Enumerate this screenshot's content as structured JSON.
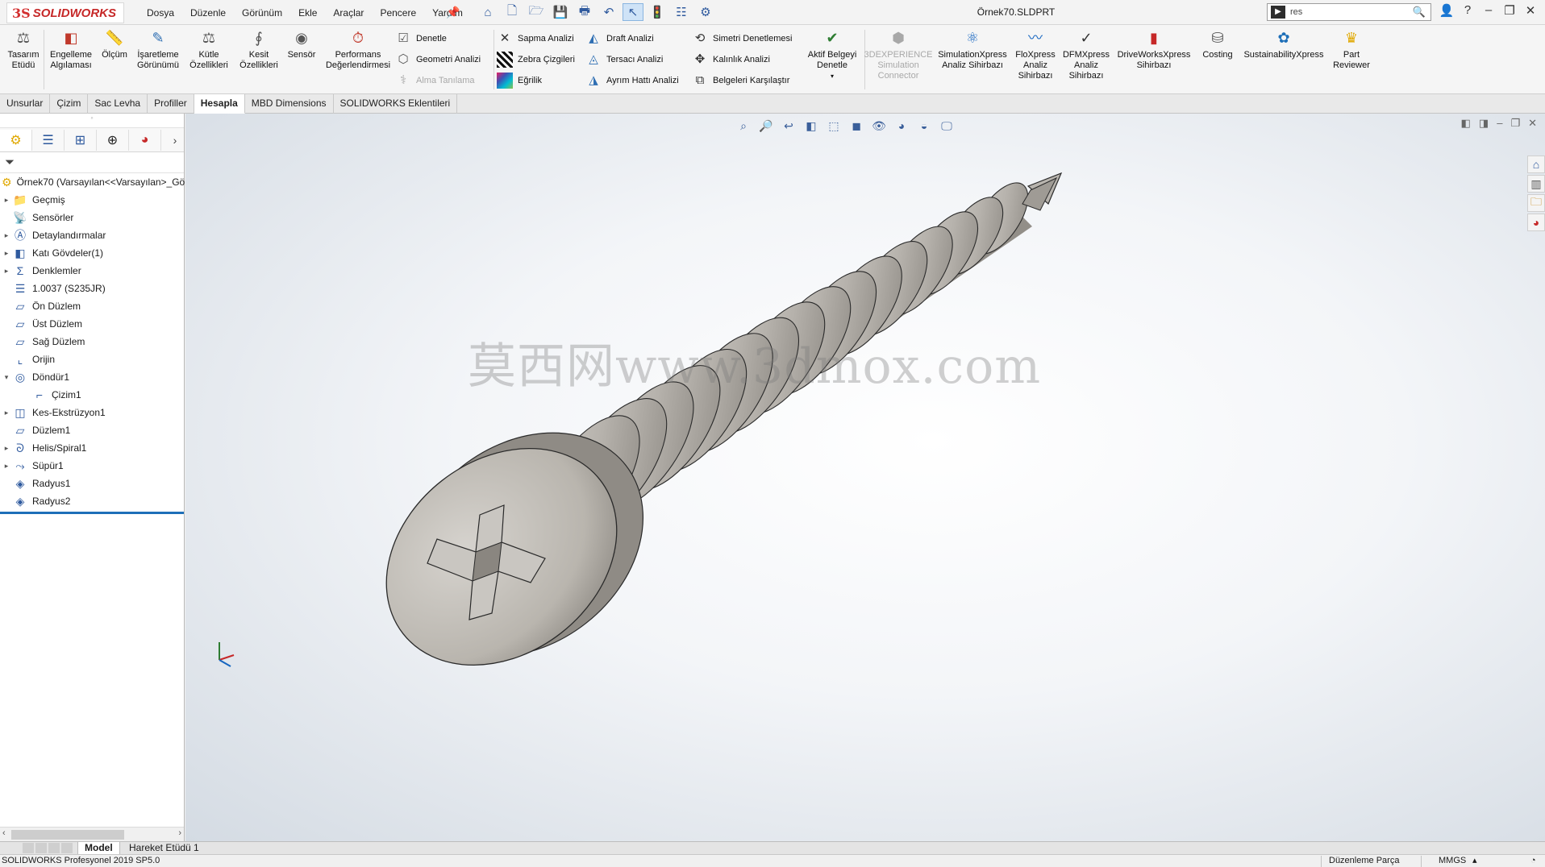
{
  "app": {
    "brand_prefix": "3S",
    "brand": "SOLIDWORKS"
  },
  "menu": [
    "Dosya",
    "Düzenle",
    "Görünüm",
    "Ekle",
    "Araçlar",
    "Pencere",
    "Yardım"
  ],
  "document_title": "Örnek70.SLDPRT",
  "search": {
    "value": "res"
  },
  "commands": {
    "tasarim_etudu": "Tasarım\nEtüdü",
    "engelleme": "Engelleme\nAlgılaması",
    "olcum": "Ölçüm",
    "isaretleme": "İşaretleme\nGörünümü",
    "kutle": "Kütle\nÖzellikleri",
    "kesit": "Kesit\nÖzellikleri",
    "sensor": "Sensör",
    "performans": "Performans\nDeğerlendirmesi",
    "denetle": "Denetle",
    "geometri": "Geometri Analizi",
    "alma": "Alma Tanılama",
    "sapma": "Sapma Analizi",
    "zebra": "Zebra Çizgileri",
    "egrilik": "Eğrilik",
    "draft": "Draft Analizi",
    "tersaci": "Tersacı Analizi",
    "ayrim": "Ayrım Hattı Analizi",
    "simetri": "Simetri Denetlemesi",
    "kalinlik": "Kalınlık Analizi",
    "belgeleri": "Belgeleri  Karşılaştır",
    "aktif": "Aktif Belgeyi\nDenetle",
    "experience": "3DEXPERIENCE\nSimulation\nConnector",
    "simxpress": "SimulationXpress\nAnaliz Sihirbazı",
    "floxpress": "FloXpress\nAnaliz\nSihirbazı",
    "dfmxpress": "DFMXpress\nAnaliz\nSihirbazı",
    "driveworks": "DriveWorksXpress\nSihirbazı",
    "costing": "Costing",
    "sustainability": "SustainabilityXpress",
    "reviewer": "Part\nReviewer"
  },
  "tabs": [
    "Unsurlar",
    "Çizim",
    "Sac Levha",
    "Profiller",
    "Hesapla",
    "MBD Dimensions",
    "SOLIDWORKS Eklentileri"
  ],
  "active_tab": "Hesapla",
  "tree": {
    "root": "Örnek70  (Varsayılan<<Varsayılan>_Gö",
    "items": [
      {
        "label": "Geçmiş",
        "expand": "▸",
        "icon": "📁"
      },
      {
        "label": "Sensörler",
        "expand": "",
        "icon": "📡"
      },
      {
        "label": "Detaylandırmalar",
        "expand": "▸",
        "icon": "Ⓐ"
      },
      {
        "label": "Katı Gövdeler(1)",
        "expand": "▸",
        "icon": "◧"
      },
      {
        "label": "Denklemler",
        "expand": "▸",
        "icon": "Σ"
      },
      {
        "label": "1.0037 (S235JR)",
        "expand": "",
        "icon": "☰"
      },
      {
        "label": "Ön Düzlem",
        "expand": "",
        "icon": "▱"
      },
      {
        "label": "Üst Düzlem",
        "expand": "",
        "icon": "▱"
      },
      {
        "label": "Sağ Düzlem",
        "expand": "",
        "icon": "▱"
      },
      {
        "label": "Orijin",
        "expand": "",
        "icon": "⌞"
      },
      {
        "label": "Döndür1",
        "expand": "▾",
        "icon": "◎"
      },
      {
        "label": "Çizim1",
        "expand": "",
        "icon": "⌐",
        "indent": true
      },
      {
        "label": "Kes-Ekstrüzyon1",
        "expand": "▸",
        "icon": "◫"
      },
      {
        "label": "Düzlem1",
        "expand": "",
        "icon": "▱"
      },
      {
        "label": "Helis/Spiral1",
        "expand": "▸",
        "icon": "ᘐ"
      },
      {
        "label": "Süpür1",
        "expand": "▸",
        "icon": "⤳"
      },
      {
        "label": "Radyus1",
        "expand": "",
        "icon": "◈"
      },
      {
        "label": "Radyus2",
        "expand": "",
        "icon": "◈"
      }
    ]
  },
  "viewport": {
    "watermark": "莫西网www.3dmox.com"
  },
  "bottom_tabs": [
    "Model",
    "Hareket Etüdü 1"
  ],
  "status": {
    "left": "SOLIDWORKS Profesyonel 2019 SP5.0",
    "mode": "Düzenleme Parça",
    "units": "MMGS"
  },
  "colors": {
    "accent": "#1e6fb8",
    "brand": "#d32f2f",
    "screw": "#c4c0ba"
  }
}
